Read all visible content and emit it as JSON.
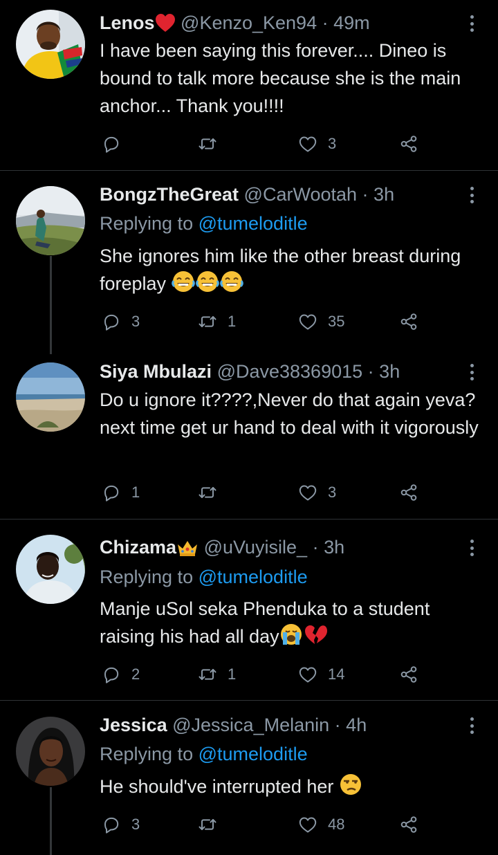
{
  "tweets": [
    {
      "name": "Lenos",
      "name_emoji": "red-heart",
      "handle": "@Kenzo_Ken94",
      "time": "49m",
      "replying_label": "",
      "replying_to": "",
      "text": "I have been saying this forever.... Dineo is bound to talk more because she is the main anchor... Thank you!!!!",
      "replies": "",
      "retweets": "",
      "likes": "3"
    },
    {
      "name": "BongzTheGreat",
      "handle": "@CarWootah",
      "time": "3h",
      "replying_label": "Replying to",
      "replying_to": "@tumeloditle",
      "text": "She ignores him like the other breast during foreplay",
      "text_emoji": "three-tears-of-joy",
      "replies": "3",
      "retweets": "1",
      "likes": "35"
    },
    {
      "name": "Siya Mbulazi",
      "handle": "@Dave38369015",
      "time": "3h",
      "replying_label": "",
      "replying_to": "",
      "text": "Do u ignore it????,Never do that again yeva?next time get ur hand to deal with it vigorously",
      "replies": "1",
      "retweets": "",
      "likes": "3"
    },
    {
      "name": "Chizama",
      "name_emoji": "crown",
      "handle": "@uVuyisile_",
      "time": "3h",
      "replying_label": "Replying to",
      "replying_to": "@tumeloditle",
      "text": "Manje uSol seka Phenduka to a student raising his had all day",
      "text_emoji": "crying-broken-heart",
      "replies": "2",
      "retweets": "1",
      "likes": "14"
    },
    {
      "name": "Jessica",
      "handle": "@Jessica_Melanin",
      "time": "4h",
      "replying_label": "Replying to",
      "replying_to": "@tumeloditle",
      "text": "He should've interrupted her",
      "text_emoji": "unamused-face",
      "replies": "3",
      "retweets": "",
      "likes": "48"
    }
  ],
  "separator": "·",
  "colors": {
    "background": "#000000",
    "text": "#e7e9ea",
    "muted": "#8b98a5",
    "link": "#1d9bf0",
    "divider": "#2f3336"
  },
  "icons": [
    "reply-icon",
    "retweet-icon",
    "like-icon",
    "share-icon",
    "more-icon"
  ]
}
